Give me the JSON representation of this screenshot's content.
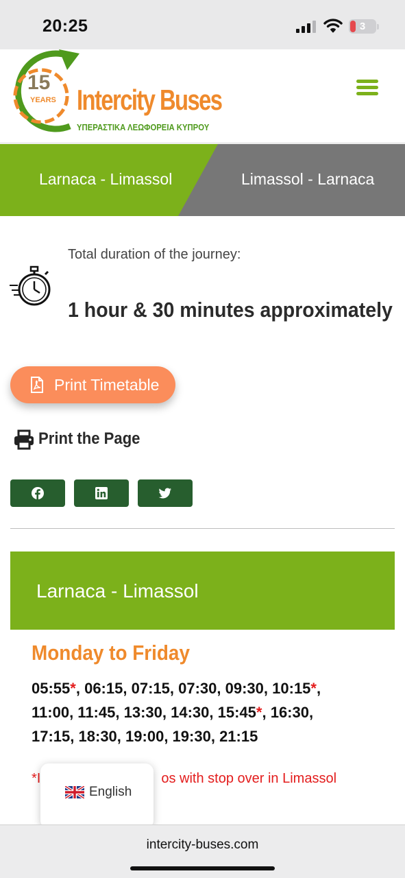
{
  "status_bar": {
    "time": "20:25",
    "battery_level": "3",
    "icons": [
      "cellular-signal-icon",
      "wifi-icon",
      "battery-icon"
    ]
  },
  "header": {
    "logo": {
      "badge_number": "15",
      "badge_word": "YEARS",
      "name": "Intercity Buses",
      "subtitle": "ΥΠΕΡΑΣΤΙΚΑ ΛΕΩΦΟΡΕΙΑ ΚΥΠΡΟΥ"
    },
    "menu_icon": "hamburger-menu-icon"
  },
  "route_tabs": [
    {
      "label": "Larnaca - Limassol",
      "active": true
    },
    {
      "label": "Limassol - Larnaca",
      "active": false
    }
  ],
  "duration": {
    "label": "Total duration of the journey:",
    "value": "1 hour & 30 minutes approximately",
    "icon": "stopwatch-icon"
  },
  "actions": {
    "print_timetable": "Print Timetable",
    "print_page": "Print the Page"
  },
  "share": {
    "buttons": [
      {
        "icon": "facebook-icon"
      },
      {
        "icon": "linkedin-icon"
      },
      {
        "icon": "twitter-icon"
      }
    ]
  },
  "timetable": {
    "route_title": "Larnaca - Limassol",
    "day": "Monday to Friday",
    "lines": [
      [
        {
          "t": "05:55",
          "star": true
        },
        {
          "t": "06:15"
        },
        {
          "t": "07:15"
        },
        {
          "t": "07:30"
        },
        {
          "t": "09:30"
        },
        {
          "t": "10:15",
          "star": true
        }
      ],
      [
        {
          "t": "11:00"
        },
        {
          "t": "11:45"
        },
        {
          "t": "13:30"
        },
        {
          "t": "14:30"
        },
        {
          "t": "15:45",
          "star": true
        },
        {
          "t": "16:30"
        }
      ],
      [
        {
          "t": "17:15"
        },
        {
          "t": "18:30"
        },
        {
          "t": "19:00"
        },
        {
          "t": "19:30"
        },
        {
          "t": "21:15"
        }
      ]
    ],
    "star_symbol": "*",
    "note_visible_start": "*I",
    "note_visible_end": "os with stop over in Limassol"
  },
  "language_popup": {
    "label": "English",
    "flag": "uk-flag-icon"
  },
  "browser": {
    "url": "intercity-buses.com"
  },
  "colors": {
    "brand_green": "#7cb11b",
    "brand_orange": "#ef8a2c",
    "button_orange": "#fb8d5b",
    "share_green": "#275e2e",
    "tab_inactive": "#777777",
    "note_red": "#e31c1c"
  }
}
